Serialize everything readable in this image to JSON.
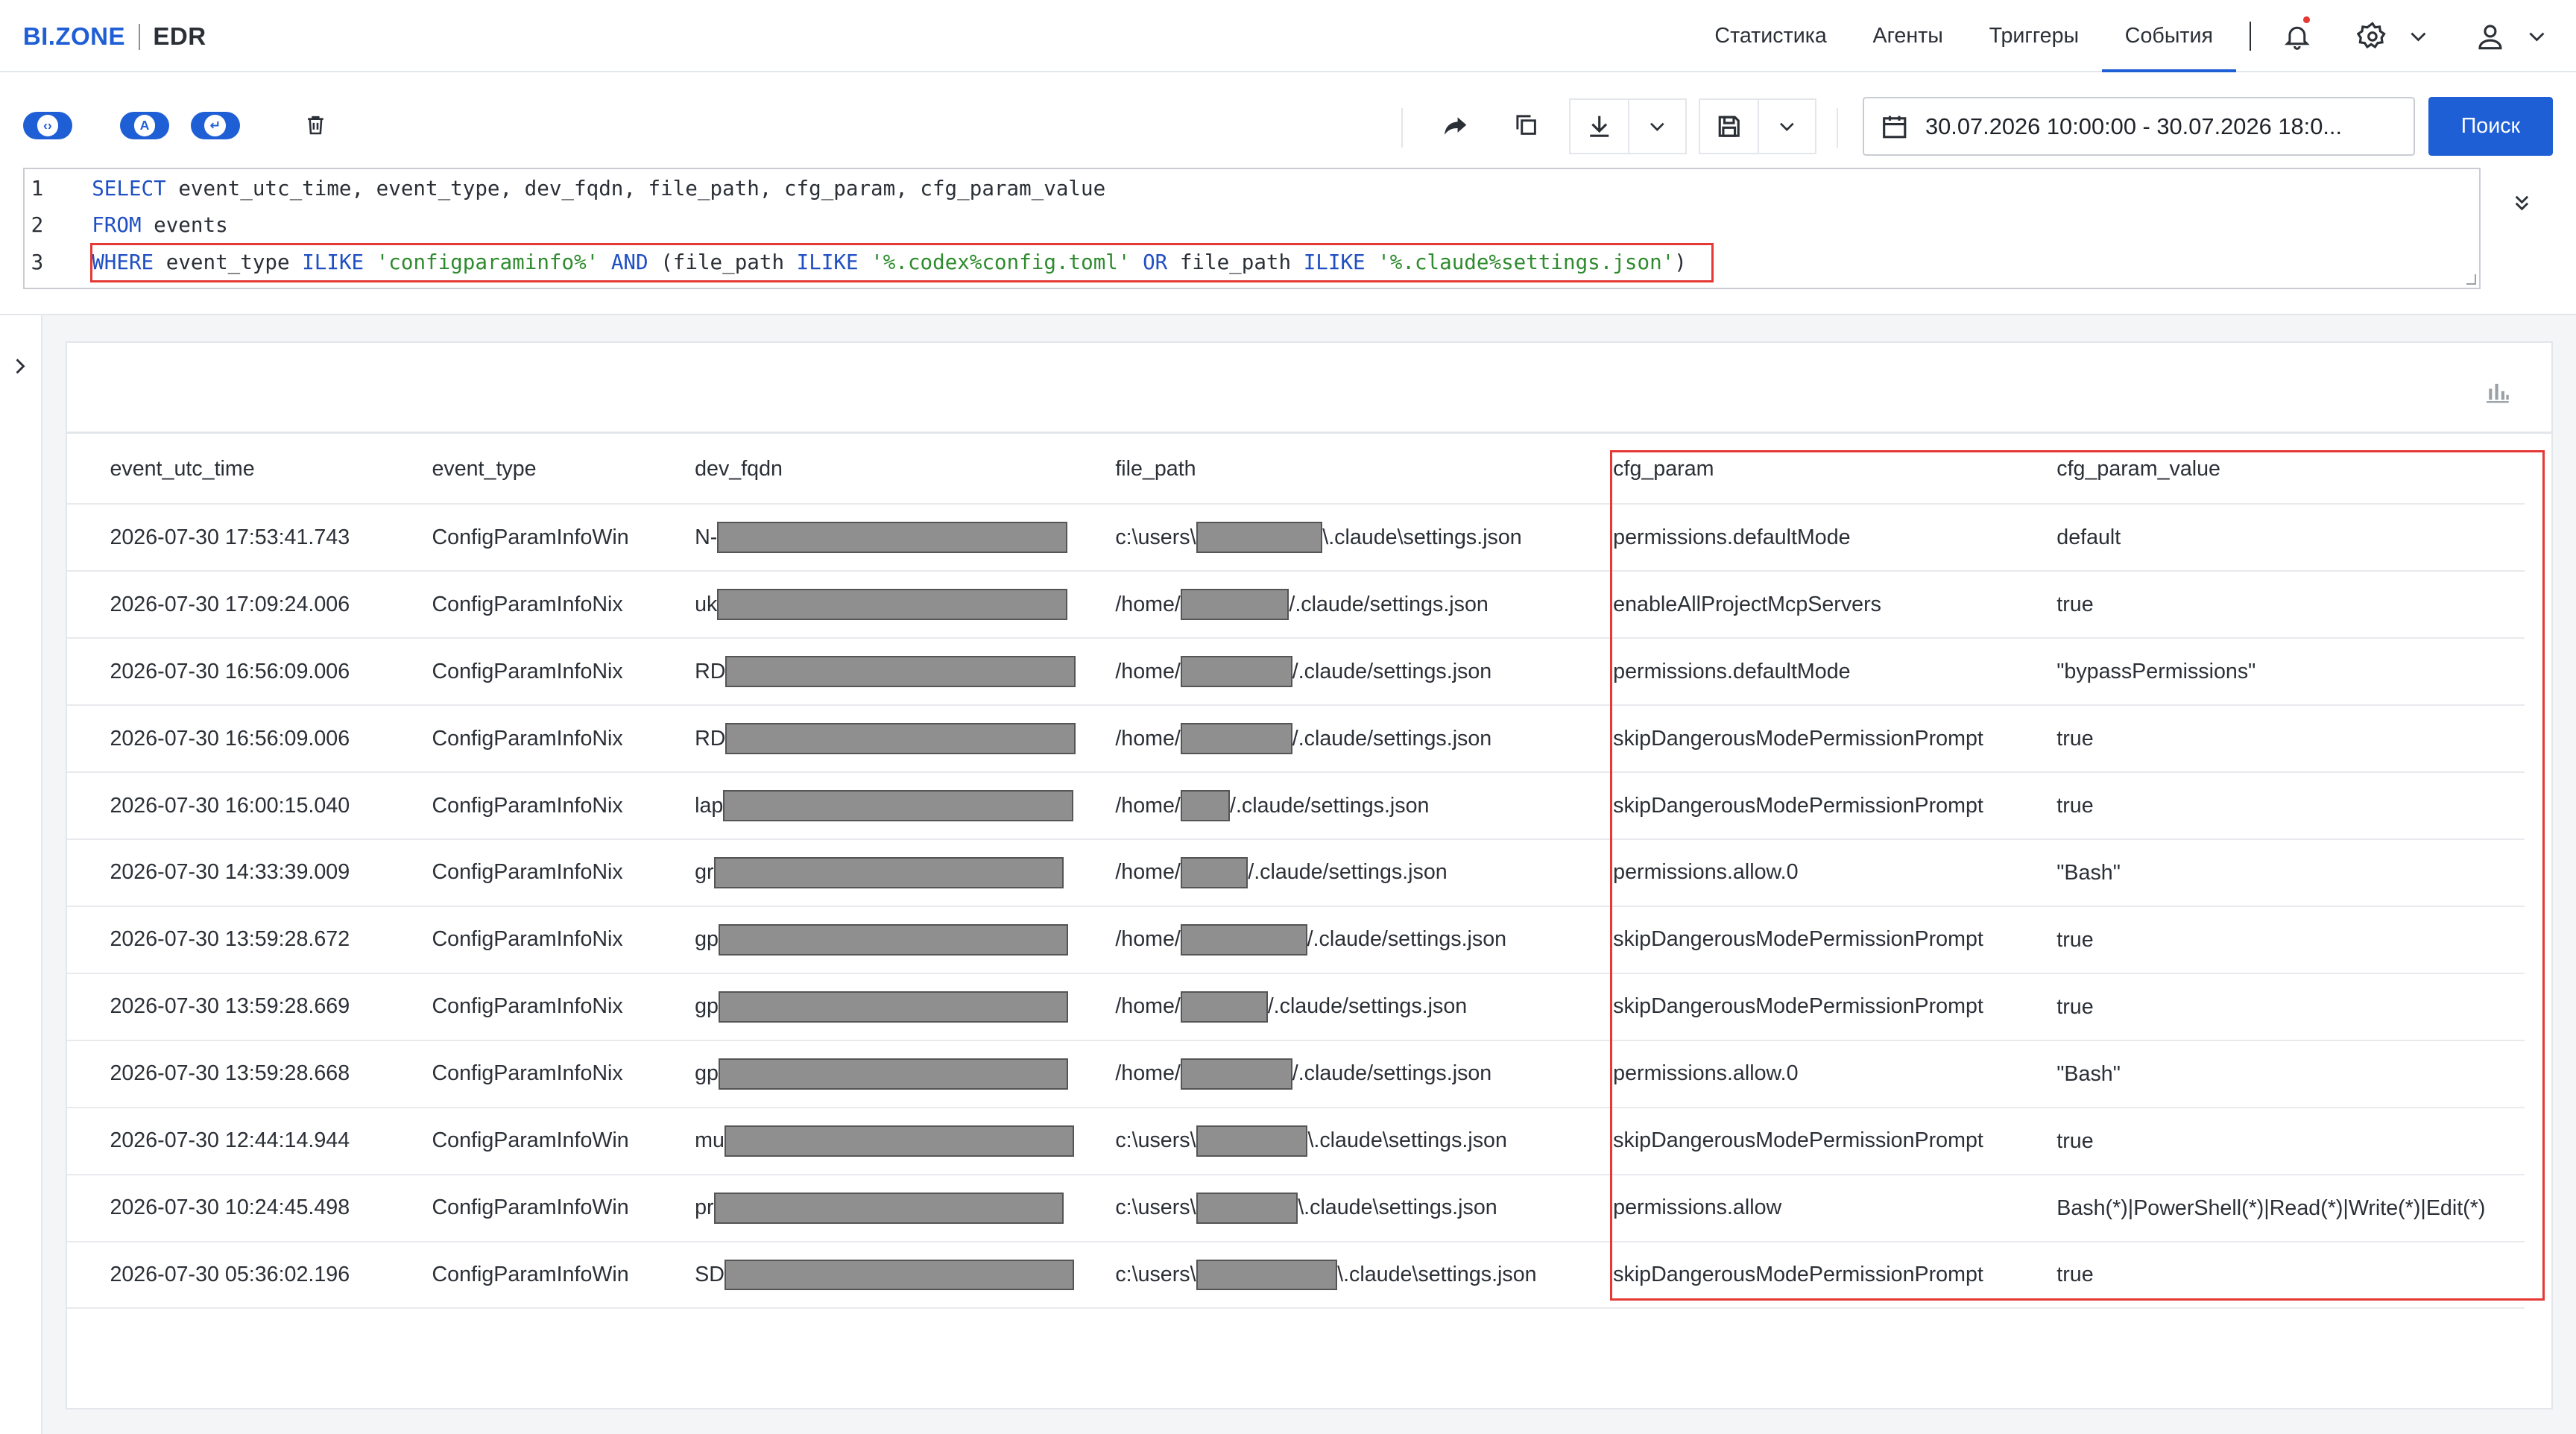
{
  "header": {
    "logo_brand": "BI.ZONE",
    "logo_product": "EDR",
    "nav": [
      {
        "label": "Статистика",
        "active": false
      },
      {
        "label": "Агенты",
        "active": false
      },
      {
        "label": "Триггеры",
        "active": false
      },
      {
        "label": "События",
        "active": true
      }
    ]
  },
  "toolbar": {
    "toggle_a_label": "A",
    "date_range": "30.07.2026 10:00:00 - 30.07.2026 18:0...",
    "search_label": "Поиск"
  },
  "editor": {
    "lines": [
      {
        "num": "1",
        "text": "SELECT event_utc_time, event_type, dev_fqdn, file_path, cfg_param, cfg_param_value"
      },
      {
        "num": "2",
        "text": "FROM events"
      },
      {
        "num": "3",
        "text": "WHERE event_type ILIKE 'configparaminfo%' AND (file_path ILIKE '%.codex%config.toml' OR file_path ILIKE '%.claude%settings.json')"
      }
    ],
    "line1": {
      "kw1": "SELECT",
      "cols": "event_utc_time, event_type, dev_fqdn, file_path, cfg_param, cfg_param_value"
    },
    "line2": {
      "kw1": "FROM",
      "cols": "events"
    },
    "line3": {
      "kw_where": "WHERE",
      "col1": "event_type",
      "kw_ilike1": "ILIKE",
      "str1": "'configparaminfo%'",
      "kw_and": "AND",
      "paren_open": "(",
      "col2": "file_path",
      "kw_ilike2": "ILIKE",
      "str2": "'%.codex%config.toml'",
      "kw_or": "OR",
      "col3": "file_path",
      "kw_ilike3": "ILIKE",
      "str3": "'%.claude%settings.json'",
      "paren_close": ")"
    }
  },
  "table": {
    "columns": [
      "event_utc_time",
      "event_type",
      "dev_fqdn",
      "file_path",
      "cfg_param",
      "cfg_param_value"
    ],
    "rows": [
      {
        "time": "2026-07-30 17:53:41.743",
        "type": "ConfigParamInfoWin",
        "fqdn_prefix": "N-",
        "path_prefix": "c:\\users\\",
        "path_suffix": "\\.claude\\settings.json",
        "param": "permissions.defaultMode",
        "value": "default"
      },
      {
        "time": "2026-07-30 17:09:24.006",
        "type": "ConfigParamInfoNix",
        "fqdn_prefix": "uk",
        "path_prefix": "/home/",
        "path_suffix": "/.claude/settings.json",
        "param": "enableAllProjectMcpServers",
        "value": "true"
      },
      {
        "time": "2026-07-30 16:56:09.006",
        "type": "ConfigParamInfoNix",
        "fqdn_prefix": "RD",
        "path_prefix": "/home/",
        "path_suffix": "/.claude/settings.json",
        "param": "permissions.defaultMode",
        "value": "\"bypassPermissions\""
      },
      {
        "time": "2026-07-30 16:56:09.006",
        "type": "ConfigParamInfoNix",
        "fqdn_prefix": "RD",
        "path_prefix": "/home/",
        "path_suffix": "/.claude/settings.json",
        "param": "skipDangerousModePermissionPrompt",
        "value": "true"
      },
      {
        "time": "2026-07-30 16:00:15.040",
        "type": "ConfigParamInfoNix",
        "fqdn_prefix": "lap",
        "path_prefix": "/home/",
        "path_suffix": "/.claude/settings.json",
        "param": "skipDangerousModePermissionPrompt",
        "value": "true"
      },
      {
        "time": "2026-07-30 14:33:39.009",
        "type": "ConfigParamInfoNix",
        "fqdn_prefix": "gr",
        "path_prefix": "/home/",
        "path_suffix": "/.claude/settings.json",
        "param": "permissions.allow.0",
        "value": "\"Bash\""
      },
      {
        "time": "2026-07-30 13:59:28.672",
        "type": "ConfigParamInfoNix",
        "fqdn_prefix": "gp",
        "path_prefix": "/home/",
        "path_suffix": "/.claude/settings.json",
        "param": "skipDangerousModePermissionPrompt",
        "value": "true"
      },
      {
        "time": "2026-07-30 13:59:28.669",
        "type": "ConfigParamInfoNix",
        "fqdn_prefix": "gp",
        "path_prefix": "/home/",
        "path_suffix": "/.claude/settings.json",
        "param": "skipDangerousModePermissionPrompt",
        "value": "true"
      },
      {
        "time": "2026-07-30 13:59:28.668",
        "type": "ConfigParamInfoNix",
        "fqdn_prefix": "gp",
        "path_prefix": "/home/",
        "path_suffix": "/.claude/settings.json",
        "param": "permissions.allow.0",
        "value": "\"Bash\""
      },
      {
        "time": "2026-07-30 12:44:14.944",
        "type": "ConfigParamInfoWin",
        "fqdn_prefix": "mu",
        "path_prefix": "c:\\users\\",
        "path_suffix": "\\.claude\\settings.json",
        "param": "skipDangerousModePermissionPrompt",
        "value": "true"
      },
      {
        "time": "2026-07-30 10:24:45.498",
        "type": "ConfigParamInfoWin",
        "fqdn_prefix": "pr",
        "path_prefix": "c:\\users\\",
        "path_suffix": "\\.claude\\settings.json",
        "param": "permissions.allow",
        "value": "Bash(*)|PowerShell(*)|Read(*)|Write(*)|Edit(*)"
      },
      {
        "time": "2026-07-30 05:36:02.196",
        "type": "ConfigParamInfoWin",
        "fqdn_prefix": "SD",
        "path_prefix": "c:\\users\\",
        "path_suffix": "\\.claude\\settings.json",
        "param": "skipDangerousModePermissionPrompt",
        "value": "true"
      }
    ]
  },
  "colors": {
    "accent": "#1f5fd6",
    "highlight": "#e53935",
    "redact": "#8f8f8f"
  },
  "icons": [
    "bell-icon",
    "gear-icon",
    "user-icon",
    "chevron-down-icon",
    "trash-icon",
    "share-icon",
    "copy-icon",
    "download-icon",
    "save-icon",
    "calendar-icon",
    "collapse-icon",
    "chevron-right-icon",
    "bar-chart-icon"
  ]
}
